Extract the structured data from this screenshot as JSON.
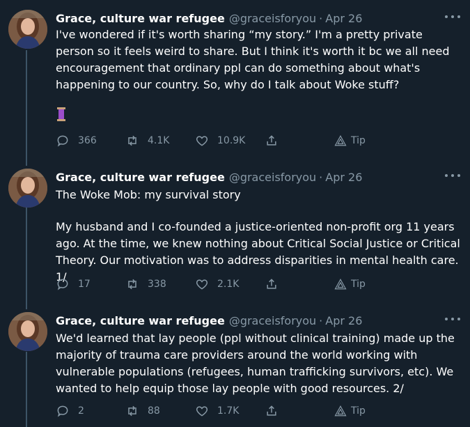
{
  "tweets": [
    {
      "name": "Grace, culture war refugee",
      "handle": "@graceisforyou",
      "separator": "·",
      "date": "Apr 26",
      "paragraphs": [
        "I've wondered if it's worth sharing “my story.” I'm a pretty private person so it feels weird to share. But I think it's worth it bc we all need encouragement that ordinary ppl can do something about what's happening to our country. So, why do I talk about Woke stuff?"
      ],
      "emoji": "thread-spool",
      "reply_count": "366",
      "retweet_count": "4.1K",
      "like_count": "10.9K",
      "tip_label": "Tip"
    },
    {
      "name": "Grace, culture war refugee",
      "handle": "@graceisforyou",
      "separator": "·",
      "date": "Apr 26",
      "paragraphs": [
        "The Woke Mob: my survival story",
        "My husband and I co-founded a justice-oriented non-profit org 11 years ago. At the time, we knew nothing about Critical Social Justice or Critical Theory. Our motivation was to address disparities in mental health care. 1/"
      ],
      "reply_count": "17",
      "retweet_count": "338",
      "like_count": "2.1K",
      "tip_label": "Tip"
    },
    {
      "name": "Grace, culture war refugee",
      "handle": "@graceisforyou",
      "separator": "·",
      "date": "Apr 26",
      "paragraphs": [
        "We'd learned that lay people (ppl without clinical training) made up the majority of trauma care providers around the world working with vulnerable populations (refugees, human trafficking survivors, etc). We wanted to help equip those lay people with good resources. 2/"
      ],
      "reply_count": "2",
      "retweet_count": "88",
      "like_count": "1.7K",
      "tip_label": "Tip"
    }
  ],
  "colors": {
    "background": "#15202b",
    "text": "#ffffff",
    "secondary": "#8899a6",
    "thread_line": "#3d5466"
  },
  "icons": [
    "reply-icon",
    "retweet-icon",
    "like-icon",
    "share-icon",
    "tip-icon",
    "more-icon"
  ]
}
